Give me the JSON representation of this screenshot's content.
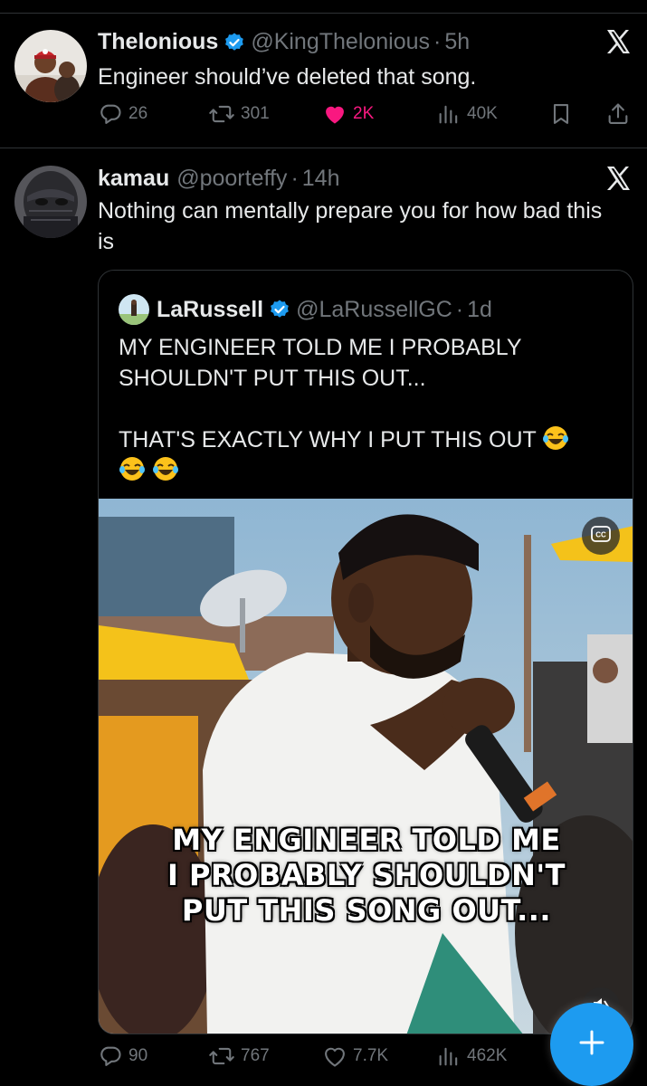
{
  "tweets": [
    {
      "name": "Thelonious",
      "handle": "@KingThelonious",
      "dot": "·",
      "time": "5h",
      "text": "Engineer should’ve deleted that song.",
      "actions": {
        "replies": "26",
        "reposts": "301",
        "likes": "2K",
        "views": "40K"
      },
      "liked": true
    },
    {
      "name": "kamau",
      "handle": "@poorteffy",
      "dot": "·",
      "time": "14h",
      "text": "Nothing can mentally prepare you for how bad this is",
      "actions": {
        "replies": "90",
        "reposts": "767",
        "likes": "7.7K",
        "views": "462K"
      },
      "liked": false
    }
  ],
  "quote": {
    "name": "LaRussell",
    "handle": "@LaRussellGC",
    "dot": "·",
    "time": "1d",
    "line1": "MY ENGINEER TOLD ME I PROBABLY SHOULDN'T PUT THIS OUT...",
    "line2": "THAT'S EXACTLY WHY I PUT THIS OUT",
    "video_caption_1": "MY ENGINEER TOLD ME",
    "video_caption_2": "I PROBABLY SHOULDN'T",
    "video_caption_3": "PUT THIS SONG OUT..."
  },
  "colors": {
    "background": "#000000",
    "text": "#e7e9ea",
    "muted": "#71767b",
    "like_pink": "#f91880",
    "verified_blue": "#1d9bf0",
    "fab_blue": "#1d9bf0"
  },
  "icons": [
    "verified-badge-icon",
    "x-logo-icon",
    "reply-icon",
    "repost-icon",
    "like-icon",
    "views-icon",
    "bookmark-icon",
    "share-icon",
    "cc-icon",
    "mute-icon",
    "plus-icon"
  ]
}
